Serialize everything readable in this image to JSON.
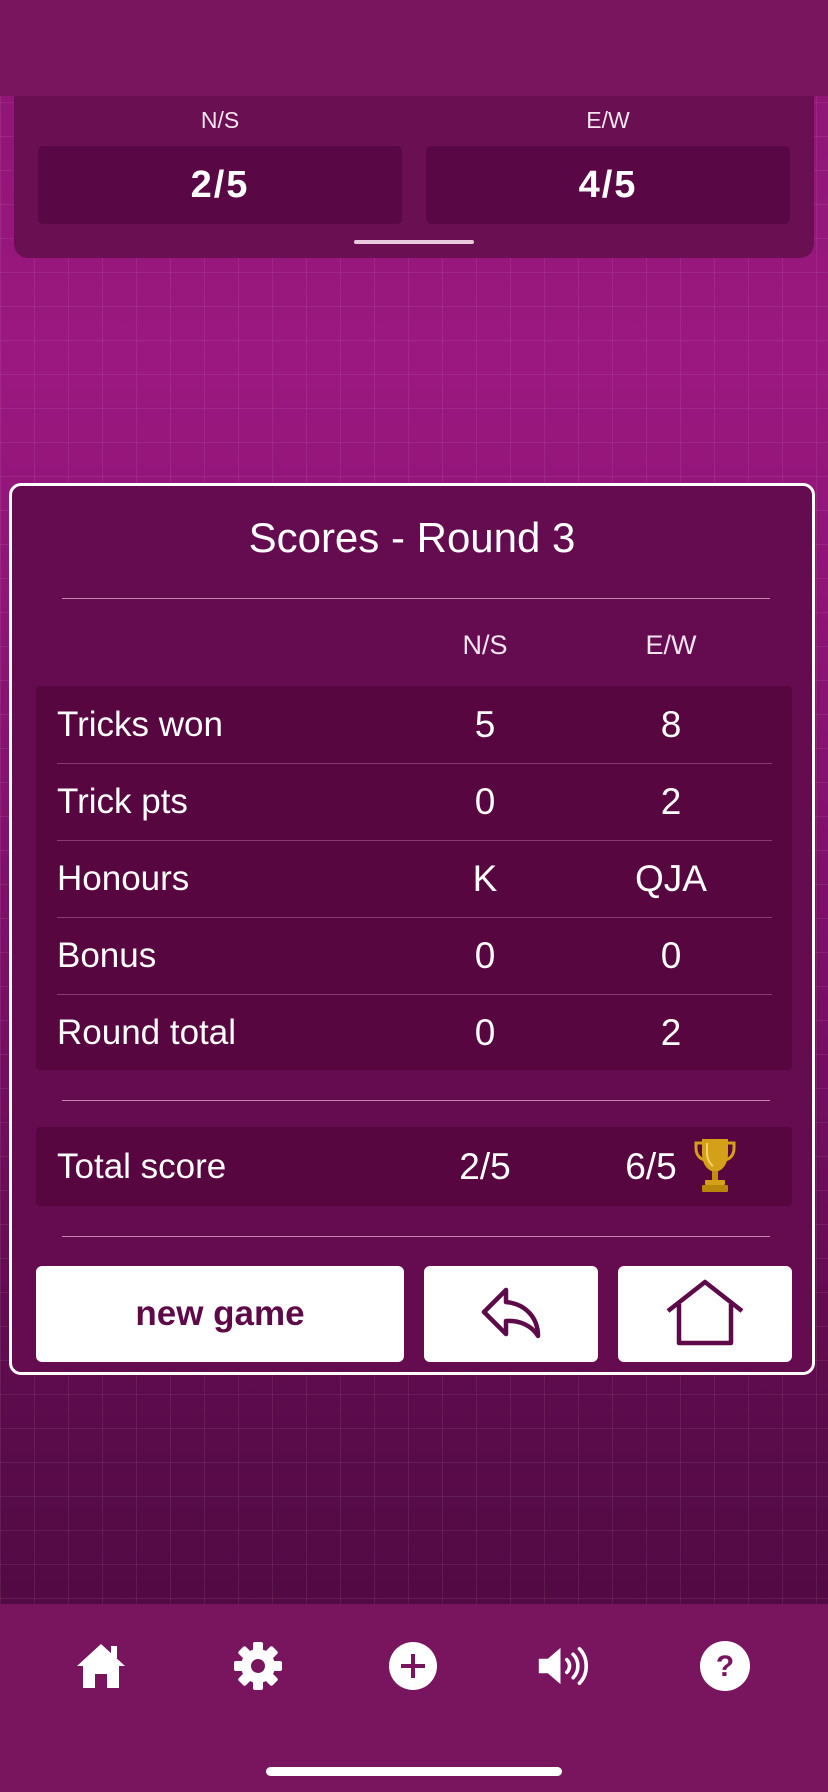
{
  "top_panel": {
    "ns_label": "N/S",
    "ns_score": "2/5",
    "ew_label": "E/W",
    "ew_score": "4/5"
  },
  "dialog": {
    "title": "Scores - Round 3",
    "col_ns": "N/S",
    "col_ew": "E/W",
    "rows": [
      {
        "label": "Tricks won",
        "ns": "5",
        "ew": "8"
      },
      {
        "label": "Trick pts",
        "ns": "0",
        "ew": "2"
      },
      {
        "label": "Honours",
        "ns": "K",
        "ew": "QJA"
      },
      {
        "label": "Bonus",
        "ns": "0",
        "ew": "0"
      },
      {
        "label": "Round total",
        "ns": "0",
        "ew": "2"
      }
    ],
    "total": {
      "label": "Total score",
      "ns": "2/5",
      "ew": "6/5",
      "winner_icon": "trophy-icon"
    },
    "buttons": {
      "new_game": "new game",
      "undo_icon": "undo-arrow-icon",
      "home_icon": "home-outline-icon"
    }
  },
  "nav": [
    "home-icon",
    "gear-icon",
    "plus-circle-icon",
    "speaker-icon",
    "help-icon"
  ],
  "colors": {
    "accent": "#5e0a49",
    "trophy": "#d4a017"
  }
}
